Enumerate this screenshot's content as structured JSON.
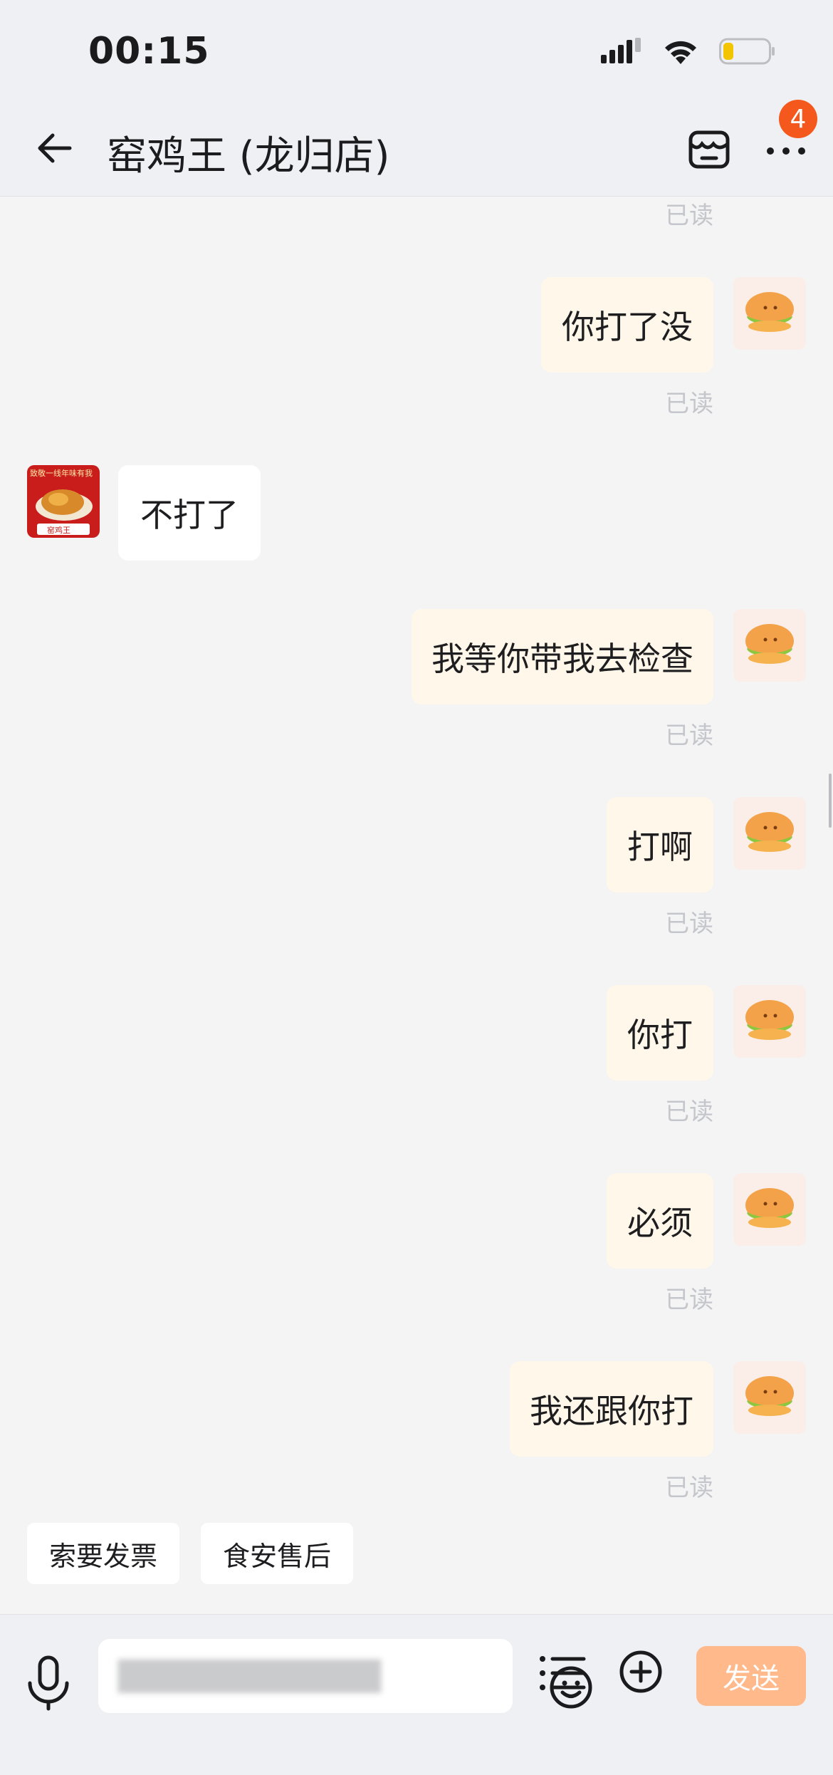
{
  "status_bar": {
    "time": "00:15"
  },
  "header": {
    "title": "窑鸡王 (龙归店)",
    "badge_count": "4"
  },
  "messages": [
    {
      "side": "out",
      "text": "",
      "read": "已读"
    },
    {
      "side": "out",
      "text": "你打了没",
      "read": "已读"
    },
    {
      "side": "in",
      "text": "不打了"
    },
    {
      "side": "out",
      "text": "我等你带我去检查",
      "read": "已读"
    },
    {
      "side": "out",
      "text": "打啊",
      "read": "已读"
    },
    {
      "side": "out",
      "text": "你打",
      "read": "已读"
    },
    {
      "side": "out",
      "text": "必须",
      "read": "已读"
    },
    {
      "side": "out",
      "text": "我还跟你打",
      "read": "已读"
    }
  ],
  "shop_avatar": {
    "banner": "致敬一线年味有我",
    "logo_text": "窑鸡王"
  },
  "quick_actions": [
    "索要发票",
    "食安售后"
  ],
  "input": {
    "blurred_text": "████████████"
  },
  "send_label": "发送",
  "colors": {
    "accent": "#f5581c",
    "send": "#ffb98b",
    "bubble_out": "#fff7e9"
  },
  "icons": [
    "back-arrow-icon",
    "store-icon",
    "more-icon",
    "microphone-icon",
    "emoji-icon",
    "list-icon",
    "plus-icon",
    "burger-avatar-icon"
  ]
}
